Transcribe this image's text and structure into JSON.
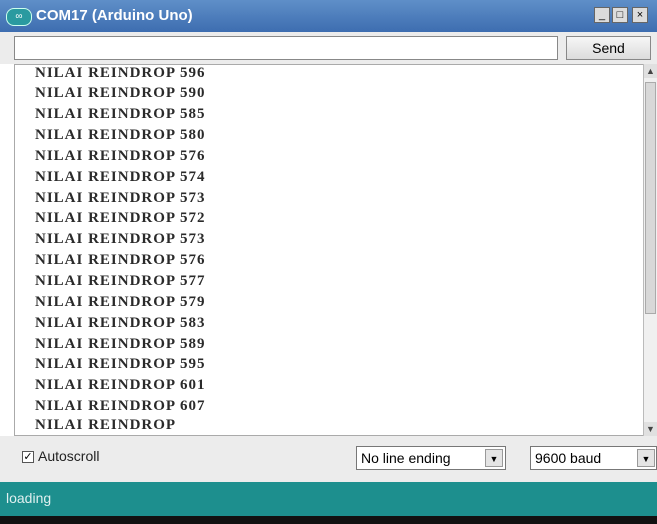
{
  "window": {
    "title": "COM17 (Arduino Uno)",
    "icon_text": "∞"
  },
  "controls": {
    "minimize": "_",
    "maximize": "□",
    "close": "×"
  },
  "send": {
    "input_value": "",
    "button_label": "Send"
  },
  "output": {
    "lines": [
      "NILAI REINDROP 596",
      "NILAI REINDROP 590",
      "NILAI REINDROP 585",
      "NILAI REINDROP 580",
      "NILAI REINDROP 576",
      "NILAI REINDROP 574",
      "NILAI REINDROP 573",
      "NILAI REINDROP 572",
      "NILAI REINDROP 573",
      "NILAI REINDROP 576",
      "NILAI REINDROP 577",
      "NILAI REINDROP 579",
      "NILAI REINDROP 583",
      "NILAI REINDROP 589",
      "NILAI REINDROP 595",
      "NILAI REINDROP 601",
      "NILAI REINDROP 607",
      "NILAI REINDROP"
    ]
  },
  "bottom": {
    "autoscroll_label": "Autoscroll",
    "autoscroll_checked": "✓",
    "line_ending": "No line ending",
    "baud": "9600 baud"
  },
  "status": {
    "text": "loading"
  }
}
